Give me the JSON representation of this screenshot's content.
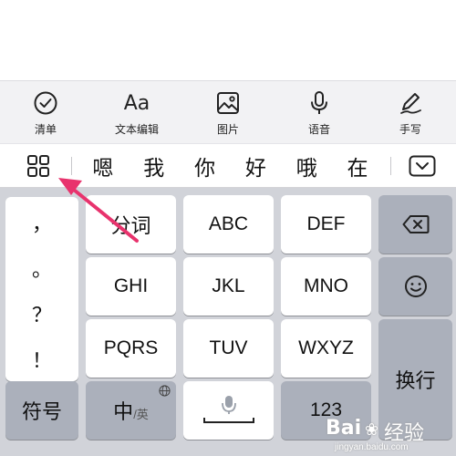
{
  "toolbar": {
    "items": [
      {
        "label": "清单",
        "icon": "checkmark-circle-icon"
      },
      {
        "label": "文本编辑",
        "icon_text": "Aa",
        "icon": "text-edit-icon"
      },
      {
        "label": "图片",
        "icon": "image-icon"
      },
      {
        "label": "语音",
        "icon": "microphone-icon"
      },
      {
        "label": "手写",
        "icon": "pen-icon"
      }
    ]
  },
  "candidates": {
    "items": [
      "嗯",
      "我",
      "你",
      "好",
      "哦",
      "在"
    ]
  },
  "keyboard": {
    "punctuation": [
      "，",
      "。",
      "？",
      "！"
    ],
    "keys": {
      "fenci": "分词",
      "abc": "ABC",
      "def": "DEF",
      "ghi": "GHI",
      "jkl": "JKL",
      "mno": "MNO",
      "pqrs": "PQRS",
      "tuv": "TUV",
      "wxyz": "WXYZ",
      "symbols": "符号",
      "zh": "中",
      "en": "/英",
      "num": "123",
      "enter": "换行"
    }
  },
  "watermark": {
    "brand": "Bai",
    "brand2": "经验",
    "url": "jingyan.baidu.com"
  },
  "colors": {
    "annotation_arrow": "#e8336d",
    "keyboard_bg": "#d1d3d9",
    "dark_key": "#abb0bb"
  }
}
